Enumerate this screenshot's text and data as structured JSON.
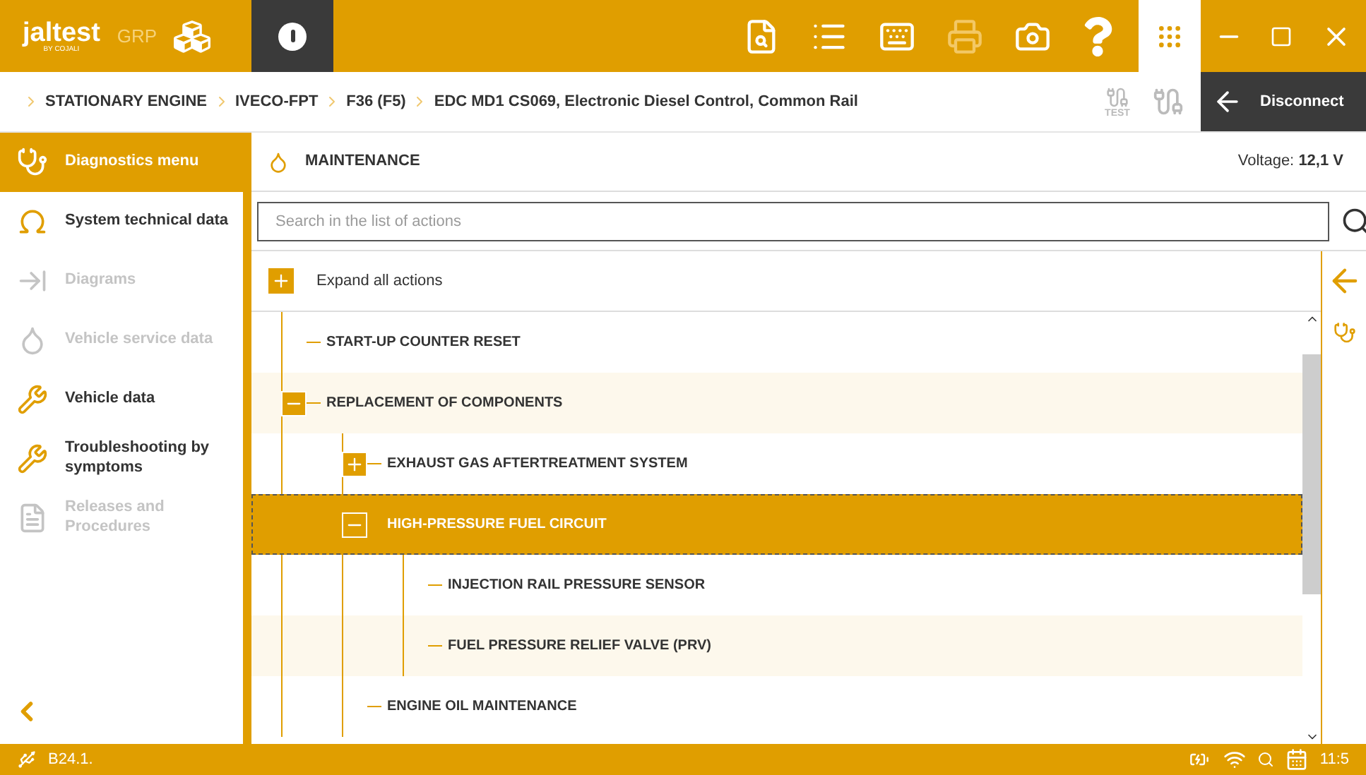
{
  "app": {
    "logo": "jaltest",
    "logo_sub": "BY COJALI",
    "product": "GRP"
  },
  "breadcrumb": [
    "STATIONARY ENGINE",
    "IVECO-FPT",
    "F36 (F5)",
    "EDC MD1 CS069, Electronic Diesel Control, Common Rail"
  ],
  "test_label": "TEST",
  "disconnect": "Disconnect",
  "sidebar": {
    "items": [
      {
        "label": "Diagnostics menu",
        "kind": "diagnostics",
        "selected": true,
        "disabled": false
      },
      {
        "label": "System technical data",
        "kind": "technical",
        "selected": false,
        "disabled": false
      },
      {
        "label": "Diagrams",
        "kind": "diagrams",
        "selected": false,
        "disabled": true
      },
      {
        "label": "Vehicle service data",
        "kind": "service",
        "selected": false,
        "disabled": true
      },
      {
        "label": "Vehicle data",
        "kind": "vehicle",
        "selected": false,
        "disabled": false
      },
      {
        "label": "Troubleshooting by symptoms",
        "kind": "troubleshooting",
        "selected": false,
        "disabled": false
      },
      {
        "label": "Releases and Procedures",
        "kind": "releases",
        "selected": false,
        "disabled": true
      }
    ]
  },
  "section": {
    "title": "MAINTENANCE",
    "voltage": "Voltage: **12,1 V**"
  },
  "search": {
    "placeholder": "Search in the list of actions"
  },
  "expand_all": "Expand all actions",
  "tree": [
    {
      "label": "START-UP COUNTER RESET",
      "selected": false
    },
    {
      "label": "REPLACEMENT OF COMPONENTS",
      "selected": false,
      "expanded": true,
      "children": [
        {
          "label": "EXHAUST GAS AFTERTREATMENT SYSTEM",
          "selected": false,
          "expanded": false
        },
        {
          "label": "HIGH-PRESSURE FUEL CIRCUIT",
          "selected": true,
          "expanded": true,
          "children": [
            {
              "label": "INJECTION RAIL PRESSURE SENSOR",
              "selected": false
            },
            {
              "label": "FUEL PRESSURE RELIEF VALVE (PRV)",
              "selected": false
            }
          ]
        },
        {
          "label": "ENGINE OIL MAINTENANCE",
          "selected": false
        }
      ]
    }
  ],
  "status_bar": {
    "version": "B24.1.",
    "time": "11:5"
  }
}
